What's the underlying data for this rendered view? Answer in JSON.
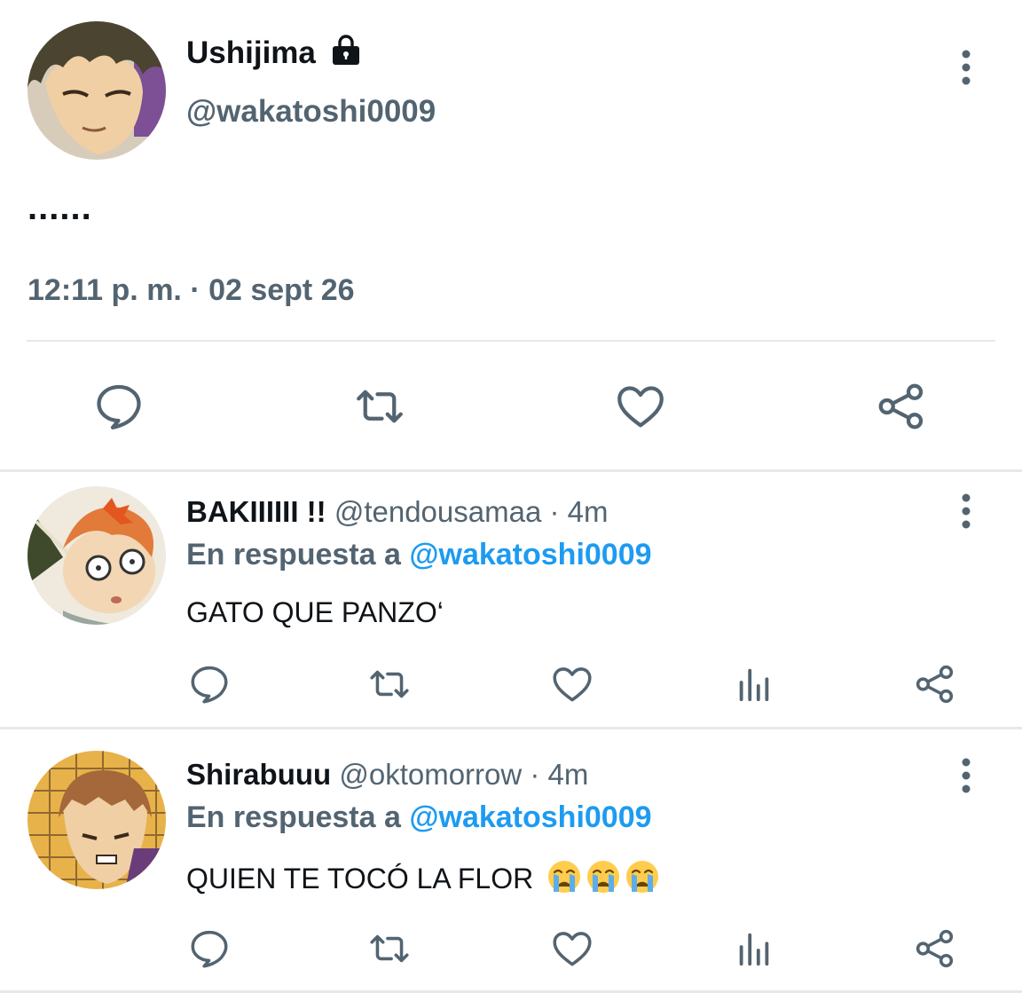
{
  "main_tweet": {
    "display_name": "Ushijima",
    "handle": "@wakatoshi0009",
    "body": "......",
    "timestamp": "12:11 p. m. · 02 sept 26",
    "actions": [
      "reply-icon",
      "retweet-icon",
      "like-icon",
      "share-icon"
    ]
  },
  "replies": [
    {
      "display_name": "BAKIIIIII !!",
      "handle": "@tendousamaa · 4m",
      "reply_prefix": "En respuesta a ",
      "reply_mention": "@wakatoshi0009",
      "text": "GATO QUE PANZO‘",
      "actions": [
        "reply-icon",
        "retweet-icon",
        "like-icon",
        "analytics-icon",
        "share-icon"
      ]
    },
    {
      "display_name": "Shirabuuu",
      "handle": "@oktomorrow · 4m",
      "reply_prefix": "En respuesta a ",
      "reply_mention": "@wakatoshi0009",
      "text": "QUIEN TE TOCÓ LA FLOR",
      "emojis": [
        "crying-face-emoji",
        "crying-face-emoji",
        "crying-face-emoji"
      ],
      "actions": [
        "reply-icon",
        "retweet-icon",
        "like-icon",
        "analytics-icon",
        "share-icon"
      ]
    }
  ],
  "colors": {
    "text_primary": "#0f1419",
    "text_secondary": "#536471",
    "link": "#1d9bf0",
    "divider": "#e6e8ea"
  }
}
